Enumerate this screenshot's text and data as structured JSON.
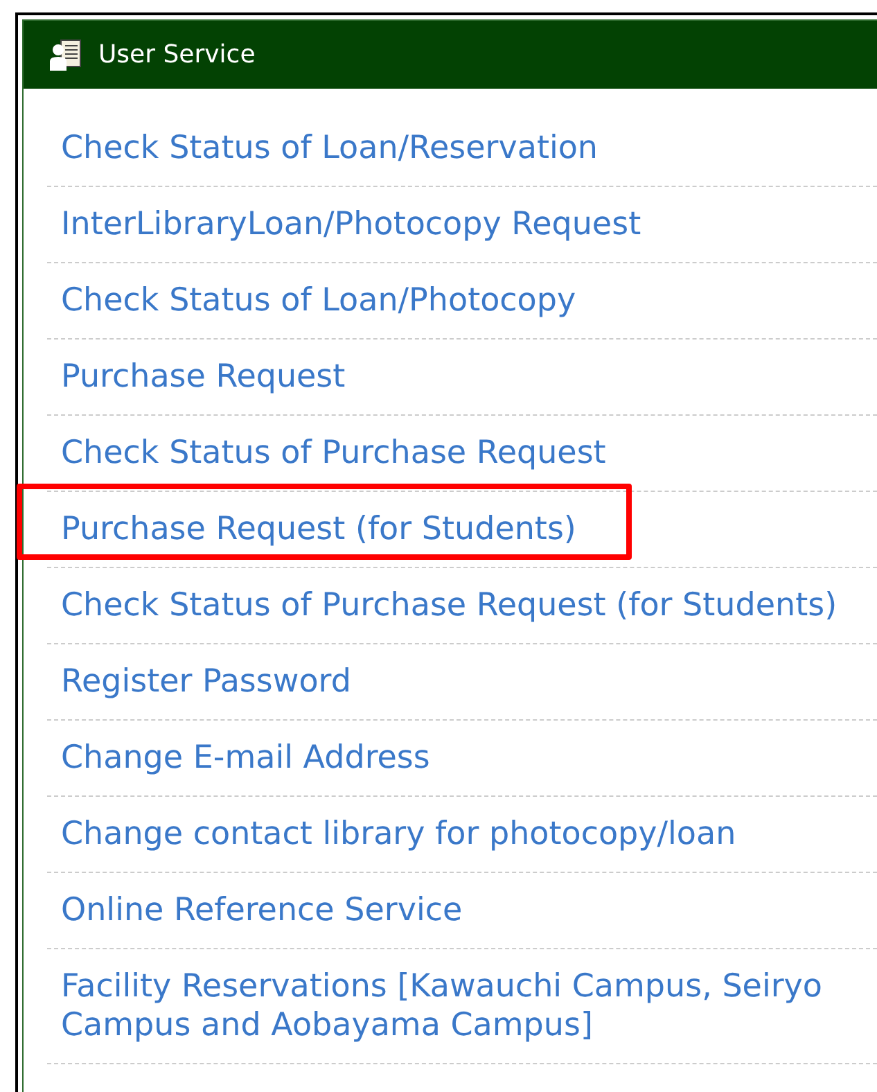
{
  "panel": {
    "title": "User Service"
  },
  "items": [
    {
      "label": "Check Status of Loan/Reservation",
      "highlighted": false
    },
    {
      "label": "InterLibraryLoan/Photocopy Request",
      "highlighted": false
    },
    {
      "label": "Check Status of Loan/Photocopy",
      "highlighted": false
    },
    {
      "label": "Purchase Request",
      "highlighted": false
    },
    {
      "label": "Check Status of Purchase Request",
      "highlighted": false
    },
    {
      "label": "Purchase Request (for Students)",
      "highlighted": true
    },
    {
      "label": "Check Status of Purchase Request (for Students)",
      "highlighted": false
    },
    {
      "label": "Register Password",
      "highlighted": false
    },
    {
      "label": "Change E-mail Address",
      "highlighted": false
    },
    {
      "label": "Change contact library for photocopy/loan",
      "highlighted": false
    },
    {
      "label": "Online Reference Service",
      "highlighted": false
    },
    {
      "label": "Facility Reservations [Kawauchi Campus, Seiryo Campus and Aobayama Campus]",
      "highlighted": false
    }
  ]
}
